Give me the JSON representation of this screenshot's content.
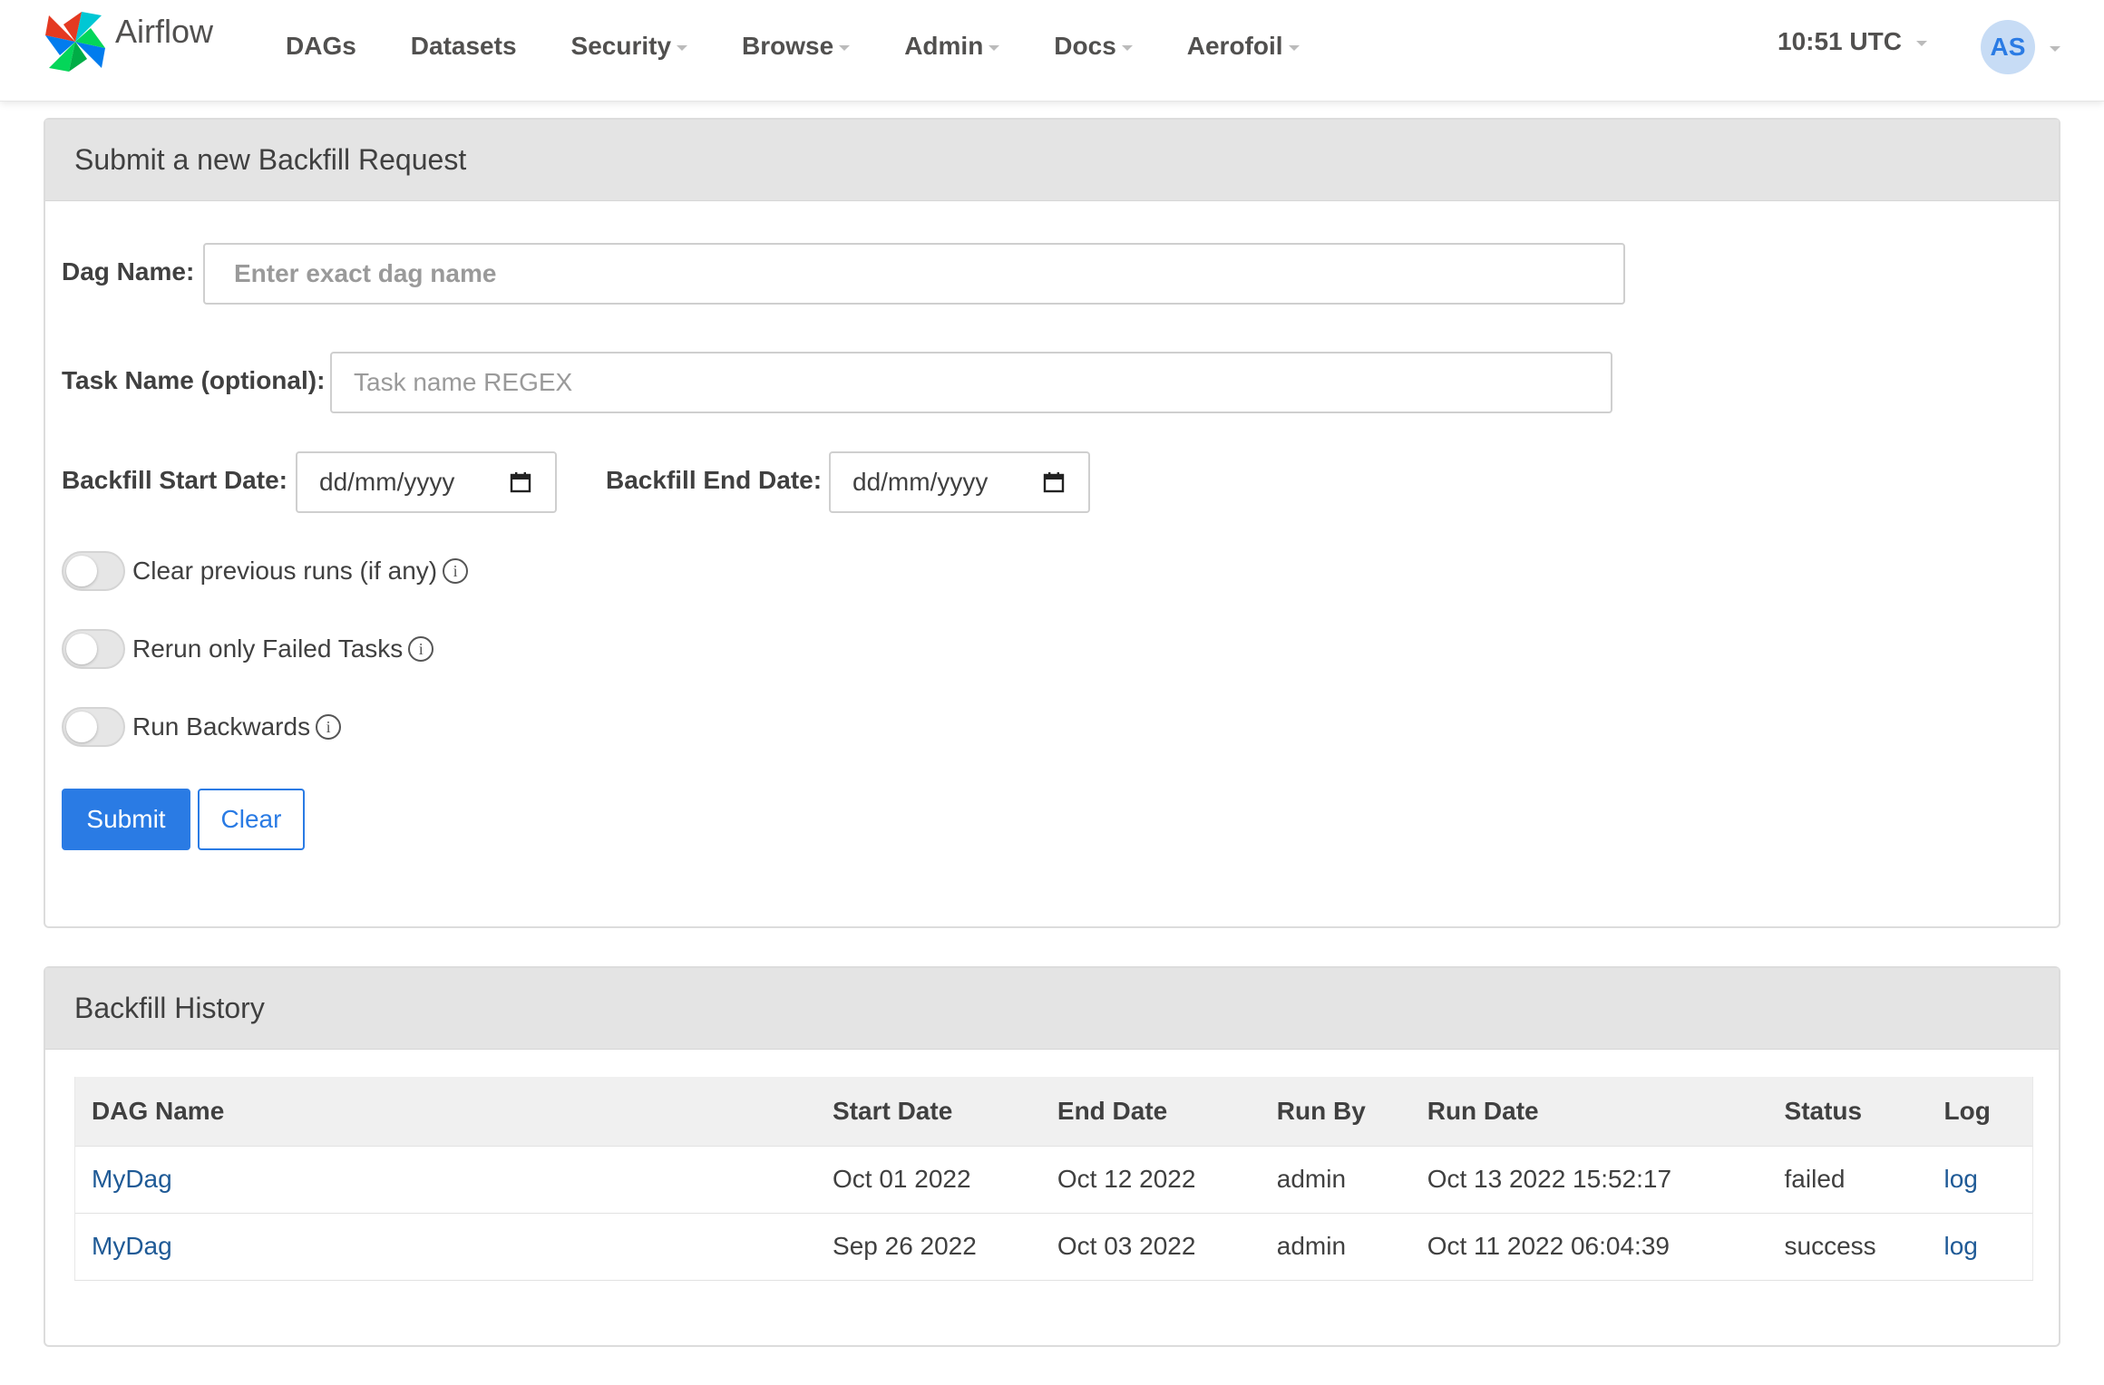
{
  "navbar": {
    "brand": "Airflow",
    "items": [
      {
        "label": "DAGs",
        "dropdown": false
      },
      {
        "label": "Datasets",
        "dropdown": false
      },
      {
        "label": "Security",
        "dropdown": true
      },
      {
        "label": "Browse",
        "dropdown": true
      },
      {
        "label": "Admin",
        "dropdown": true
      },
      {
        "label": "Docs",
        "dropdown": true
      },
      {
        "label": "Aerofoil",
        "dropdown": true
      }
    ],
    "clock": "10:51 UTC",
    "user_initials": "AS"
  },
  "form": {
    "title": "Submit a new Backfill Request",
    "dag_name_label": "Dag Name:",
    "dag_name_placeholder": "Enter exact dag name",
    "task_name_label": "Task Name (optional):",
    "task_name_placeholder": "Task name REGEX",
    "start_date_label": "Backfill Start Date:",
    "start_date_value": "dd/mm/yyyy",
    "end_date_label": "Backfill End Date:",
    "end_date_value": "dd/mm/yyyy",
    "toggles": [
      {
        "label": "Clear previous runs (if any)",
        "on": false
      },
      {
        "label": "Rerun only Failed Tasks",
        "on": false
      },
      {
        "label": "Run Backwards",
        "on": false
      }
    ],
    "submit_label": "Submit",
    "clear_label": "Clear"
  },
  "history": {
    "title": "Backfill History",
    "columns": [
      "DAG Name",
      "Start Date",
      "End Date",
      "Run By",
      "Run Date",
      "Status",
      "Log"
    ],
    "rows": [
      [
        "MyDag",
        "Oct 01 2022",
        "Oct 12 2022",
        "admin",
        "Oct 13 2022 15:52:17",
        "failed",
        "log"
      ],
      [
        "MyDag",
        "Sep 26 2022",
        "Oct 03 2022",
        "admin",
        "Oct 11 2022 06:04:39",
        "success",
        "log"
      ]
    ]
  },
  "colors": {
    "primary": "#2a7be4",
    "link": "#1f5a96",
    "panel_heading_bg": "#e4e4e4"
  }
}
